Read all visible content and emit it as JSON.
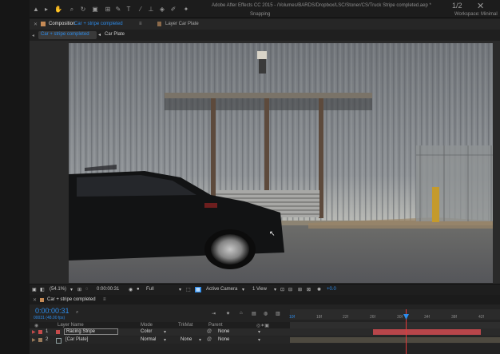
{
  "window": {
    "title": "Adobe After Effects CC 2015 - /Volumes/BARDS/Dropbox/LSC/Stoner/CS/Truck Stripe completed.aep *",
    "page_indicator": "1/2",
    "snapping": "Snapping",
    "workspace_label": "Workspace:",
    "workspace_value": "Minimal"
  },
  "panel_tabs": {
    "composition_prefix": "Composition",
    "composition_name": "Car + stripe completed",
    "layer_tab": "Layer Car Plate"
  },
  "breadcrumbs": [
    "Car + stripe completed",
    "Car Plate"
  ],
  "viewer": {
    "zoom": "(54.1%)",
    "timecode": "0:00:00:31",
    "resolution": "Full",
    "camera": "Active Camera",
    "views": "1 View",
    "exposure": "+0.0"
  },
  "timeline": {
    "tab": "Car + stripe completed",
    "timecode": "0:00:00:31",
    "frames": "00031 (48.00 fps)",
    "headers": {
      "layer_name": "Layer Name",
      "mode": "Mode",
      "trkmat": "TrkMat",
      "parent": "Parent"
    },
    "layers": [
      {
        "num": "1",
        "name": "Racing Stripe",
        "mode": "Color",
        "trkmat": "",
        "parent": "None",
        "color": "#c64b4b"
      },
      {
        "num": "2",
        "name": "[Car Plate]",
        "mode": "Normal",
        "trkmat": "None",
        "parent": "None",
        "color": "#9a7a5a"
      }
    ],
    "ruler": [
      "14f",
      "18f",
      "22f",
      "26f",
      "30f",
      "34f",
      "38f",
      "42f"
    ]
  },
  "colors": {
    "accent": "#2d8ceb",
    "layer_bar": "#b8464a",
    "playhead": "#e33a3a"
  }
}
